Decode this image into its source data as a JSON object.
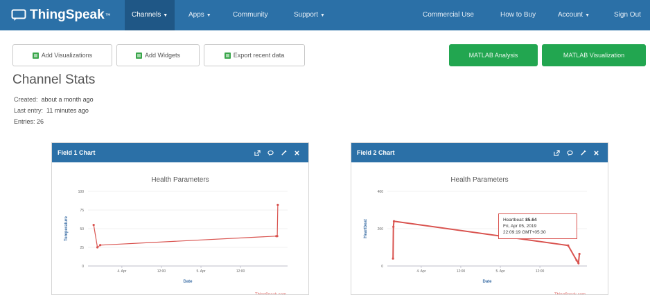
{
  "brand": {
    "name": "ThingSpeak",
    "tm": "™"
  },
  "nav": {
    "left": [
      {
        "label": "Channels",
        "dropdown": true,
        "active": true
      },
      {
        "label": "Apps",
        "dropdown": true
      },
      {
        "label": "Community"
      },
      {
        "label": "Support",
        "dropdown": true
      }
    ],
    "right": [
      {
        "label": "Commercial Use"
      },
      {
        "label": "How to Buy"
      },
      {
        "label": "Account",
        "dropdown": true
      },
      {
        "label": "Sign Out"
      }
    ]
  },
  "toolbar": {
    "add_visualizations": "Add Visualizations",
    "add_widgets": "Add Widgets",
    "export_recent": "Export recent data",
    "matlab_analysis": "MATLAB Analysis",
    "matlab_visualization": "MATLAB Visualization"
  },
  "stats": {
    "title": "Channel Stats",
    "created_label": "Created:",
    "created_value": "about a month ago",
    "last_entry_label": "Last entry:",
    "last_entry_value": "11 minutes ago",
    "entries": "Entries: 26"
  },
  "panels": [
    {
      "title": "Field 1 Chart"
    },
    {
      "title": "Field 2 Chart"
    }
  ],
  "colors": {
    "navbar": "#2b70a7",
    "accent_green": "#22a650",
    "series": "#d9534f"
  },
  "chart_data": [
    {
      "type": "line",
      "title": "Health Parameters",
      "xlabel": "Date",
      "ylabel": "Temperature",
      "credit": "ThingSpeak.com",
      "xticks": [
        "4. Apr",
        "12:00",
        "5. Apr",
        "12:00"
      ],
      "yticks": [
        0,
        25,
        50,
        75,
        100
      ],
      "ylim": [
        0,
        100
      ],
      "x": [
        0,
        0.2,
        0.35,
        9.7,
        9.75,
        9.78
      ],
      "y": [
        55,
        25,
        28,
        40,
        40,
        82
      ],
      "xlim": [
        -0.3,
        10.3
      ],
      "tick_positions": [
        1.5,
        3.6,
        5.7,
        7.8
      ]
    },
    {
      "type": "line",
      "title": "Health Parameters",
      "xlabel": "Date",
      "ylabel": "Heartbeat",
      "credit": "ThingSpeak.com",
      "xticks": [
        "4. Apr",
        "12:00",
        "5. Apr",
        "12:00"
      ],
      "yticks": [
        0,
        200,
        400
      ],
      "ylim": [
        0,
        400
      ],
      "x": [
        0,
        0.02,
        0.05,
        9.3,
        9.75,
        9.85,
        9.9
      ],
      "y": [
        40,
        210,
        240,
        110,
        30,
        15,
        65
      ],
      "xlim": [
        -0.3,
        10.3
      ],
      "tick_positions": [
        1.5,
        3.6,
        5.7,
        7.8
      ],
      "tooltip": {
        "series": "Heartbeat:",
        "value": "85.64",
        "date": "Fri, Apr 05, 2019",
        "time": "22:09:19 GMT+05:30"
      }
    }
  ]
}
